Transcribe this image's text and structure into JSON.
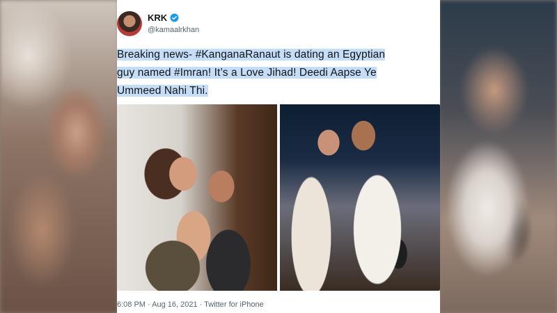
{
  "tweet": {
    "display_name": "KRK",
    "handle": "@kamaalrkhan",
    "text_line1": "Breaking news- #KanganaRanaut is dating an Egyptian",
    "text_line2": "guy named #Imran! It’s a Love Jihad! Deedi Aapse Ye",
    "text_line3": "Ummeed Nahi Thi.",
    "timestamp": "6:08 PM · Aug 16, 2021 · Twitter for iPhone",
    "verified_icon": "verified-badge-icon",
    "selection_color": "#c5ddf7",
    "verified_color": "#1d9bf0"
  }
}
